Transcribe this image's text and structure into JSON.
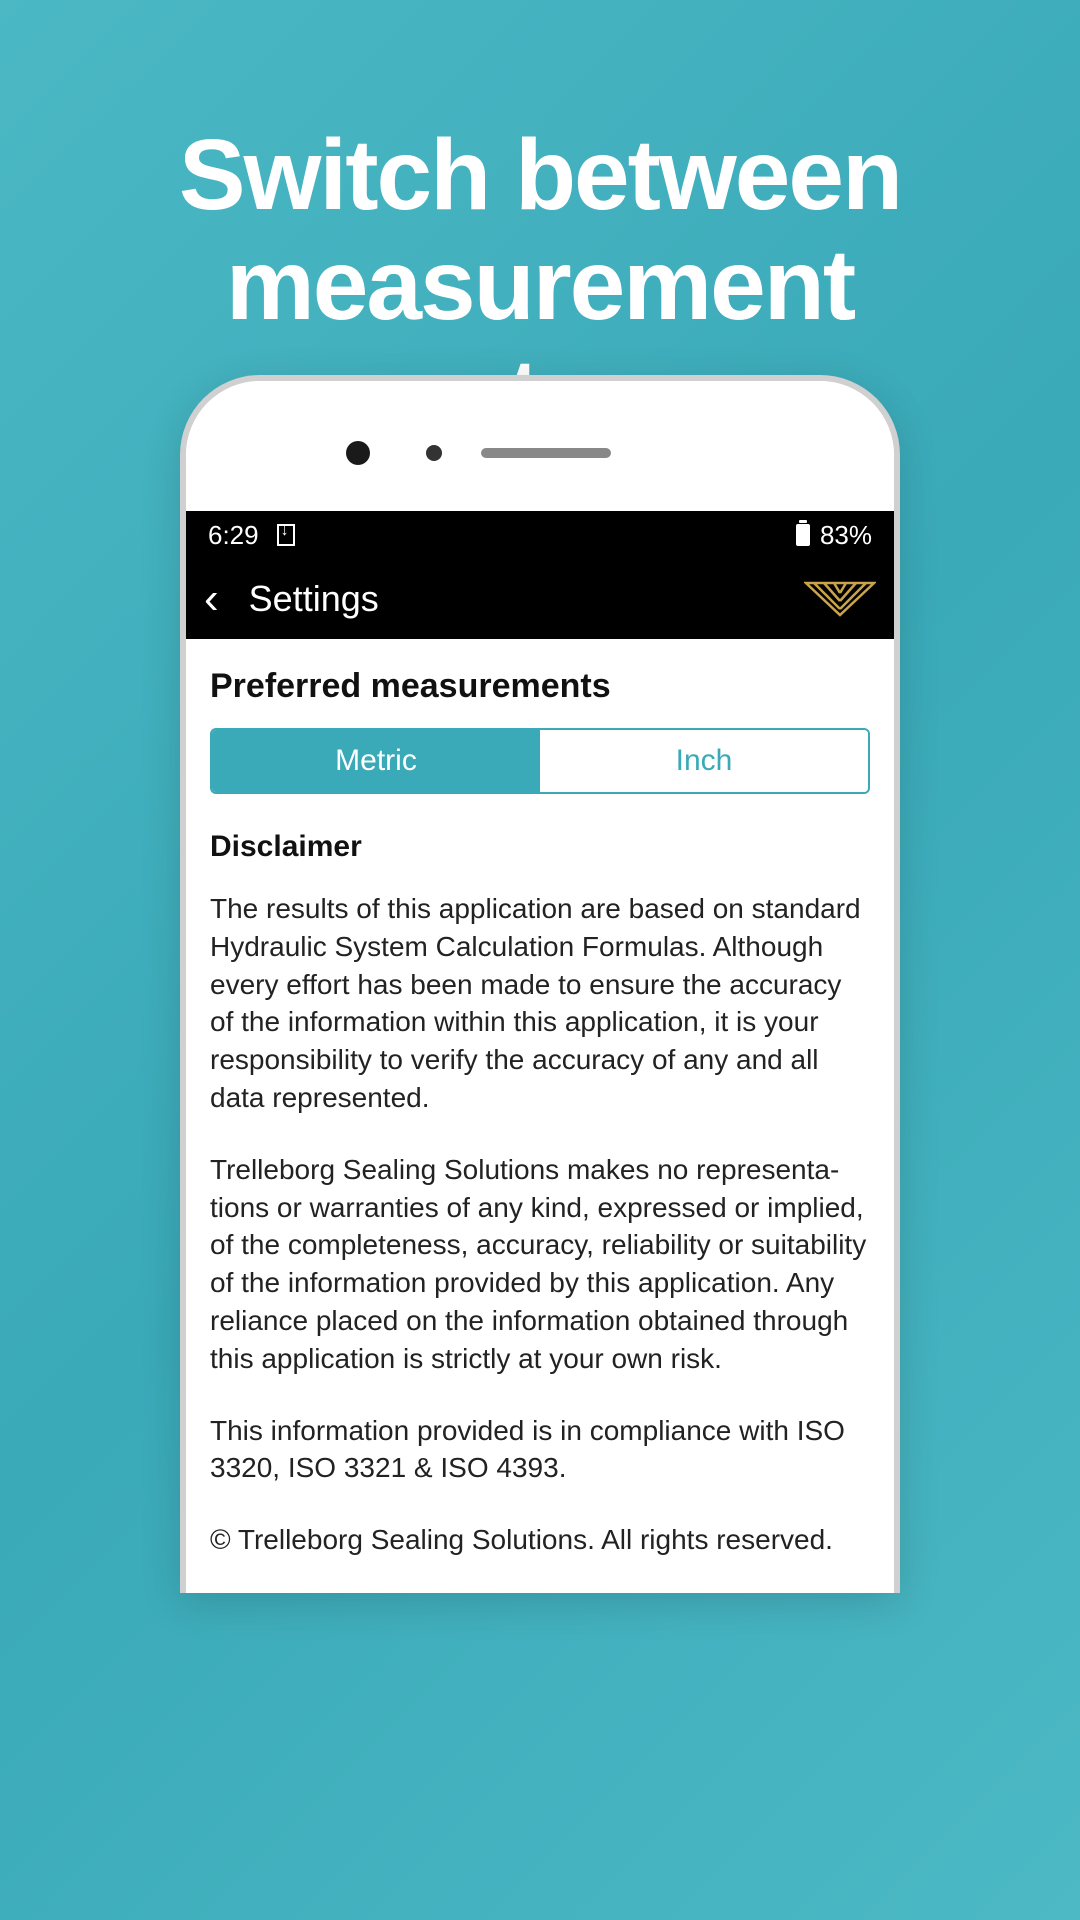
{
  "hero": {
    "title": "Switch between measurement systems"
  },
  "status_bar": {
    "time": "6:29",
    "battery": "83%"
  },
  "header": {
    "title": "Settings"
  },
  "content": {
    "preferred_measurements_label": "Preferred measurements",
    "segments": {
      "metric": "Metric",
      "inch": "Inch"
    },
    "disclaimer_heading": "Disclaimer",
    "paragraph1": "The results of this application are based on standard Hydraulic System Calculation Formulas. Although every effort has been made to ensure the accuracy of the information within this application, it is your responsibility to verify the accuracy of any and all data represented.",
    "paragraph2": "Trelleborg Sealing Solutions makes no representa­tions or warranties of any kind, expressed or implied, of the completeness, accuracy, reliability or suitability of the information provided by this application. Any reliance placed on the information obtained through this application is strictly at your own risk.",
    "paragraph3": "This information provided is in compliance with ISO 3320, ISO 3321 & ISO 4393.",
    "copyright": "© Trelleborg Sealing Solutions. All rights reserved."
  },
  "colors": {
    "accent": "#3aa9b8",
    "logo_gold": "#c9a44a"
  }
}
